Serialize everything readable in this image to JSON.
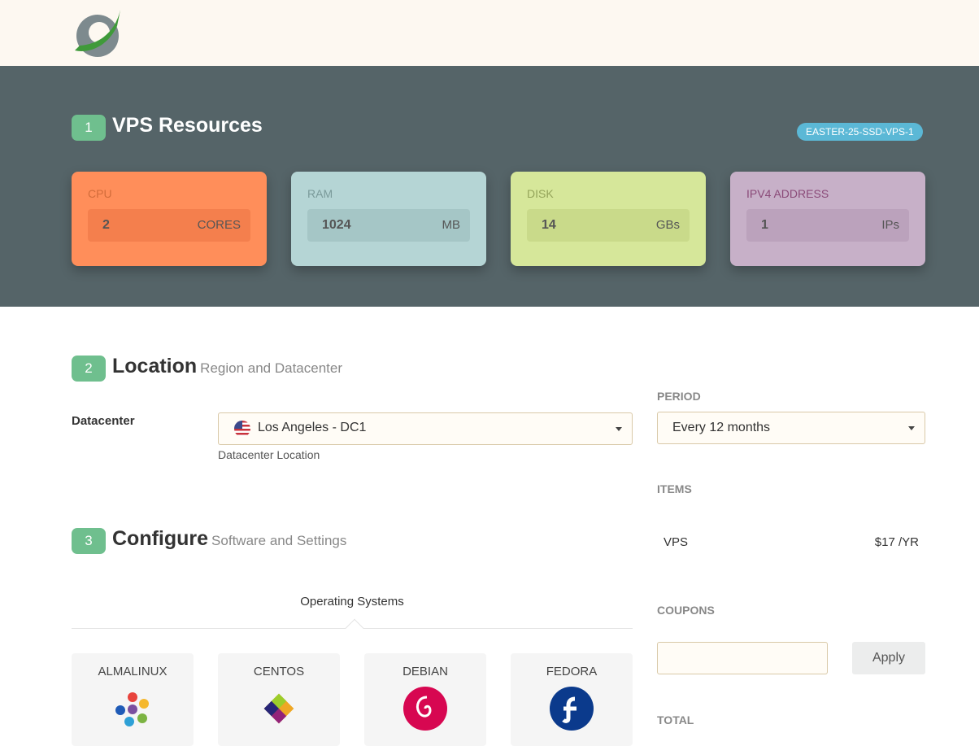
{
  "hero": {
    "step": "1",
    "title": "VPS Resources",
    "promo_code": "EASTER-25-SSD-VPS-1",
    "resources": [
      {
        "label": "CPU",
        "value": "2",
        "unit": "CORES",
        "color": "#ff8e5a",
        "field_color": "#f47f4d",
        "label_color": "#d26c3a"
      },
      {
        "label": "RAM",
        "value": "1024",
        "unit": "MB",
        "color": "#b5d5d5",
        "field_color": "#a5c6c6",
        "label_color": "#7a9a9a"
      },
      {
        "label": "DISK",
        "value": "14",
        "unit": "GBs",
        "color": "#d6e79a",
        "field_color": "#c9da8a",
        "label_color": "#94a45a"
      },
      {
        "label": "IPV4 ADDRESS",
        "value": "1",
        "unit": "IPs",
        "color": "#c7b0c8",
        "field_color": "#bba2bc",
        "label_color": "#8a4a78"
      }
    ]
  },
  "location": {
    "step": "2",
    "title": "Location",
    "subtitle": "Region and Datacenter",
    "datacenter_label": "Datacenter",
    "datacenter_value": "Los Angeles - DC1",
    "datacenter_help": "Datacenter Location"
  },
  "configure": {
    "step": "3",
    "title": "Configure",
    "subtitle": "Software and Settings",
    "tab_label": "Operating Systems",
    "os": [
      "ALMALINUX",
      "CENTOS",
      "DEBIAN",
      "FEDORA"
    ]
  },
  "summary": {
    "period_label": "PERIOD",
    "period_value": "Every 12 months",
    "items_label": "ITEMS",
    "item_name": "VPS",
    "item_price": "$17 /YR",
    "coupons_label": "COUPONS",
    "coupon_placeholder": "",
    "apply_label": "Apply",
    "total_label": "TOTAL"
  },
  "colors": {
    "accent": "#6fbf8e",
    "hero_bg": "#556468",
    "topbar_bg": "#fdf8f1"
  }
}
